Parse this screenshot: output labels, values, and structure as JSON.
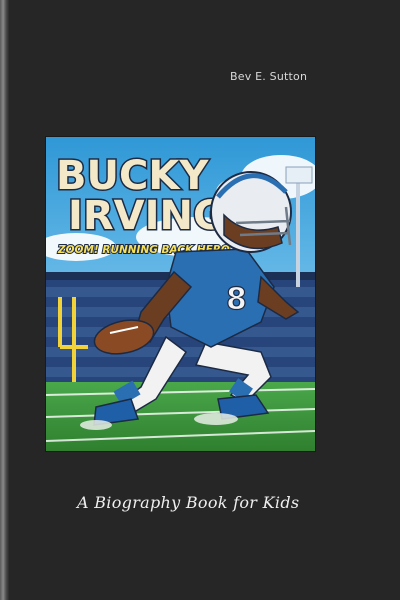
{
  "book": {
    "author": "Bev E. Sutton",
    "subtitle": "A Biography Book for Kids",
    "cover_art": {
      "title_line1": "BUCKY",
      "title_line2": "IRVING",
      "tagline": "ZOOM! RUNNING BACK HERO",
      "jersey_number": "8"
    }
  },
  "colors": {
    "background": "#262626",
    "sky": "#3aa6e0",
    "jersey": "#2b6fb3",
    "field": "#3f9a3a",
    "title_fill": "#f3e9c9",
    "title_outline": "#1c2a44"
  }
}
